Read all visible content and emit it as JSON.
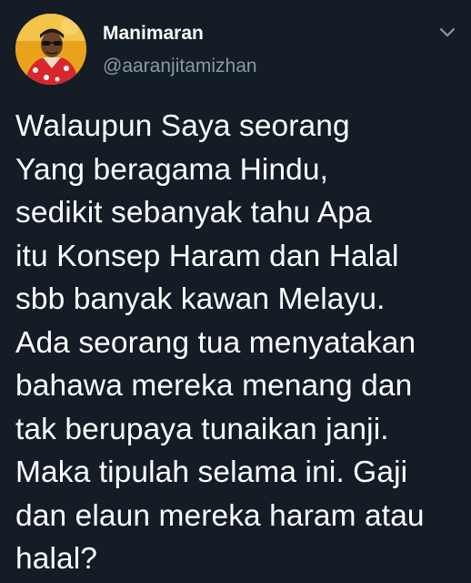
{
  "tweet": {
    "author": {
      "display_name": "Manimaran",
      "handle": "@aaranjitamizhan"
    },
    "menu_icon": "chevron-down-icon",
    "text_lines": [
      "Walaupun Saya seorang",
      "Yang beragama Hindu,",
      "sedikit sebanyak tahu Apa",
      "itu Konsep Haram dan Halal",
      "sbb banyak kawan Melayu.",
      "Ada seorang tua menyatakan",
      "bahawa mereka menang dan",
      "tak berupaya tunaikan janji.",
      "Maka tipulah selama ini. Gaji",
      "dan elaun mereka haram atau",
      "halal?"
    ]
  },
  "colors": {
    "background": "#141d26",
    "text_primary": "#ffffff",
    "text_secondary": "#8899a6"
  }
}
